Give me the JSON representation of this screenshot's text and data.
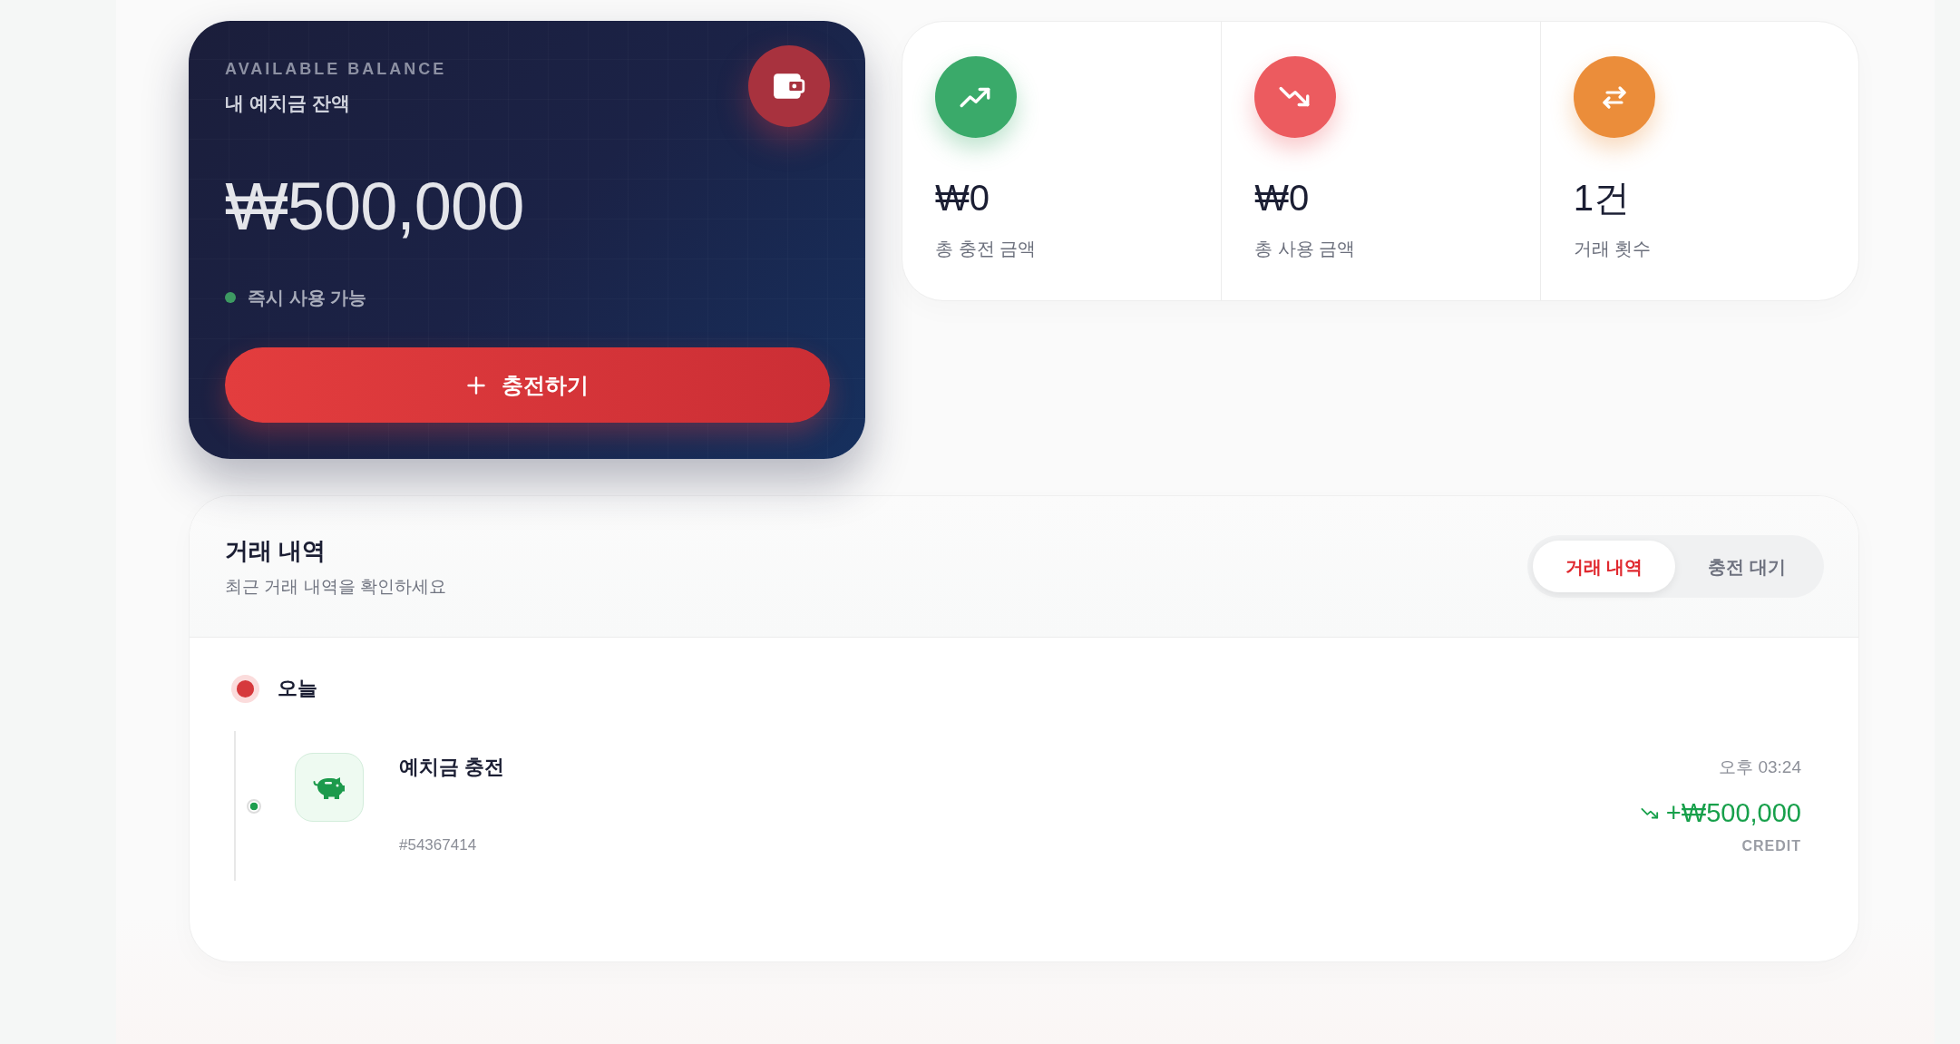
{
  "balance_card": {
    "eyebrow": "AVAILABLE BALANCE",
    "title": "내 예치금 잔액",
    "amount": "₩500,000",
    "status": "즉시 사용 가능",
    "charge_button": "충전하기"
  },
  "stats": [
    {
      "kind": "charged",
      "color": "#3aaa6a",
      "value": "₩0",
      "label": "총 충전 금액"
    },
    {
      "kind": "spent",
      "color": "#ec5b5f",
      "value": "₩0",
      "label": "총 사용 금액"
    },
    {
      "kind": "count",
      "color": "#eb8d3a",
      "value": "1건",
      "label": "거래 횟수"
    }
  ],
  "history": {
    "title": "거래 내역",
    "subtitle": "최근 거래 내역을 확인하세요",
    "tabs": [
      {
        "label": "거래 내역",
        "selected": true
      },
      {
        "label": "충전 대기",
        "selected": false
      }
    ],
    "groups": [
      {
        "date": "오늘",
        "items": [
          {
            "title": "예치금 충전",
            "id": "#54367414",
            "time": "오후 03:24",
            "amount": "+₩500,000",
            "type_label": "CREDIT"
          }
        ]
      }
    ]
  }
}
